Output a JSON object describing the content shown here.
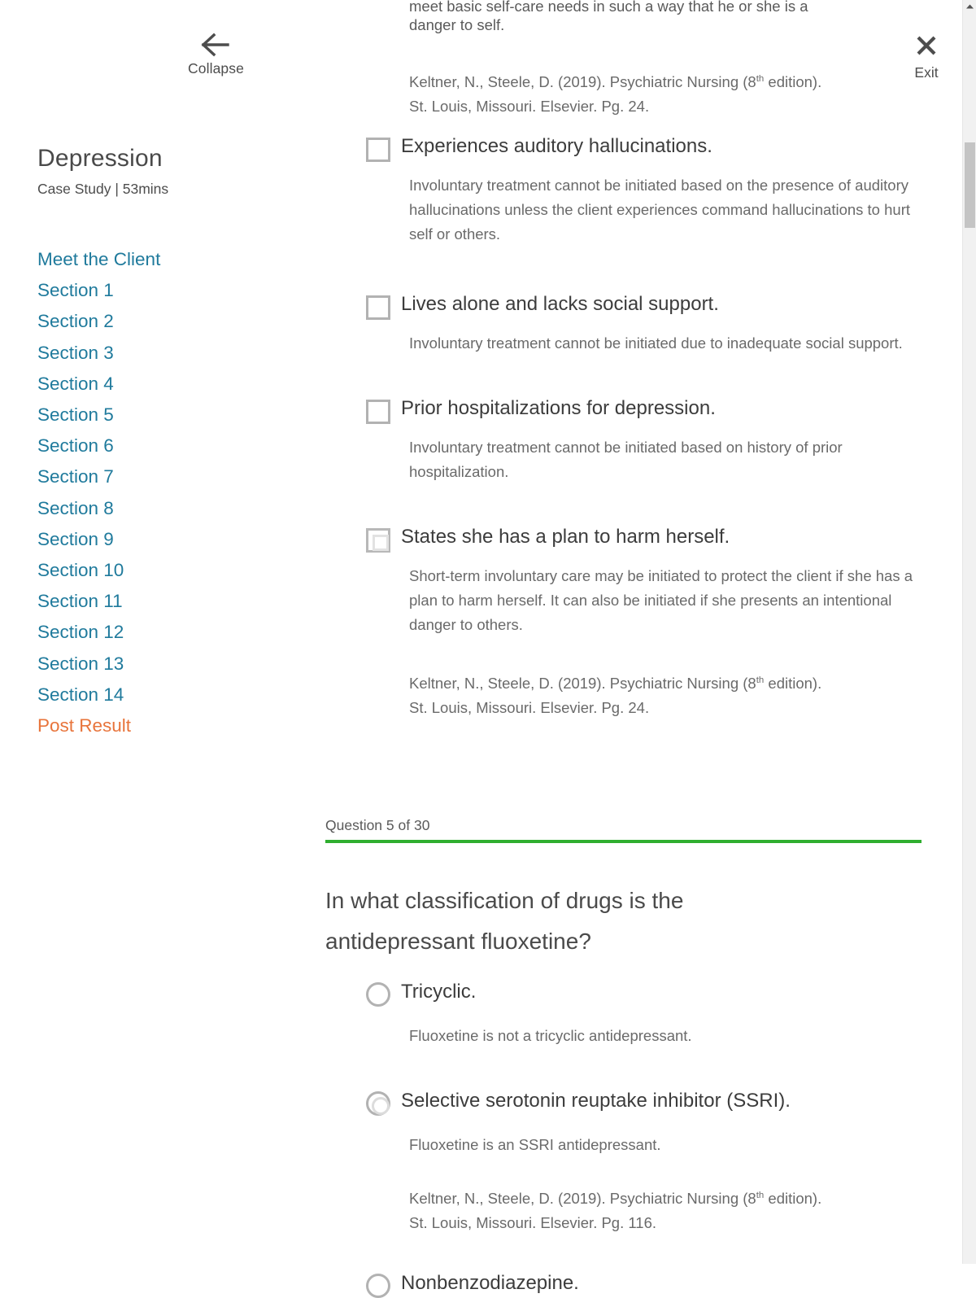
{
  "sidebar": {
    "collapse": {
      "label": "Collapse",
      "icon": "arrow-left-icon"
    },
    "course_title": "Depression",
    "course_meta": "Case Study | 53mins",
    "items": [
      {
        "label": "Meet the Client",
        "accent": false
      },
      {
        "label": "Section 1",
        "accent": false
      },
      {
        "label": "Section 2",
        "accent": false
      },
      {
        "label": "Section 3",
        "accent": false
      },
      {
        "label": "Section 4",
        "accent": false
      },
      {
        "label": "Section 5",
        "accent": false
      },
      {
        "label": "Section 6",
        "accent": false
      },
      {
        "label": "Section 7",
        "accent": false
      },
      {
        "label": "Section 8",
        "accent": false
      },
      {
        "label": "Section 9",
        "accent": false
      },
      {
        "label": "Section 10",
        "accent": false
      },
      {
        "label": "Section 11",
        "accent": false
      },
      {
        "label": "Section 12",
        "accent": false
      },
      {
        "label": "Section 13",
        "accent": false
      },
      {
        "label": "Section 14",
        "accent": false
      },
      {
        "label": "Post Result",
        "accent": true
      }
    ]
  },
  "exit": {
    "label": "Exit",
    "icon": "close-icon"
  },
  "main": {
    "clipped_line": "meet basic self-care needs in such a way that he or she is a",
    "lead_paragraph": "danger to self.",
    "citation_top_line1_pre": "Keltner, N., Steele, D. (2019). Psychiatric Nursing (8",
    "citation_sup": "th",
    "citation_top_line1_post": " edition).",
    "citation_top_line2": "St. Louis, Missouri. Elsevier. Pg. 24.",
    "checkbox_options": [
      {
        "label": "Experiences auditory hallucinations.",
        "rationale": "Involuntary treatment cannot be initiated based on the presence of auditory hallucinations unless the client experiences command hallucinations to hurt self or others.",
        "marked": false
      },
      {
        "label": "Lives alone and lacks social support.",
        "rationale": "Involuntary treatment cannot be initiated due to inadequate social support.",
        "marked": false
      },
      {
        "label": "Prior hospitalizations for depression.",
        "rationale": "Involuntary treatment cannot be initiated based on history of prior hospitalization.",
        "marked": false
      },
      {
        "label": "States she has a plan to harm herself.",
        "rationale": "Short-term involuntary care may be initiated to protect the client if she has a plan to harm herself. It can also be initiated if she presents an intentional danger to others.",
        "marked": true
      }
    ],
    "citation_mid_line1_pre": "Keltner, N., Steele, D. (2019). Psychiatric Nursing (8",
    "citation_mid_sup": "th",
    "citation_mid_line1_post": " edition).",
    "citation_mid_line2": "St. Louis, Missouri. Elsevier. Pg. 24."
  },
  "question": {
    "counter": "Question 5 of 30",
    "number": 5,
    "total": 30,
    "text": "In what classification of drugs is the antidepressant fluoxetine?",
    "radio_options": [
      {
        "label": "Tricyclic.",
        "rationale": "Fluoxetine is not a tricyclic antidepressant.",
        "marked": false,
        "citation_line1_pre": "",
        "citation_sup": "",
        "citation_line1_post": "",
        "citation_line2": ""
      },
      {
        "label": "Selective serotonin reuptake inhibitor (SSRI).",
        "rationale": "Fluoxetine is an SSRI antidepressant.",
        "marked": true,
        "citation_line1_pre": "Keltner, N., Steele, D. (2019). Psychiatric Nursing (8",
        "citation_sup": "th",
        "citation_line1_post": " edition).",
        "citation_line2": "St. Louis, Missouri. Elsevier. Pg. 116."
      },
      {
        "label": "Nonbenzodiazepine.",
        "rationale": "",
        "marked": false,
        "citation_line1_pre": "",
        "citation_sup": "",
        "citation_line1_post": "",
        "citation_line2": ""
      }
    ]
  },
  "colors": {
    "link": "#1f7a9c",
    "accent": "#e8743b",
    "progress": "#2fae2f",
    "text": "#4a4a4a",
    "muted": "#6a6a6a",
    "checkbox_border": "#b2b2b2"
  },
  "scrollbar": {
    "up_icon": "triangle-up-icon",
    "thumb": "scroll-thumb"
  }
}
